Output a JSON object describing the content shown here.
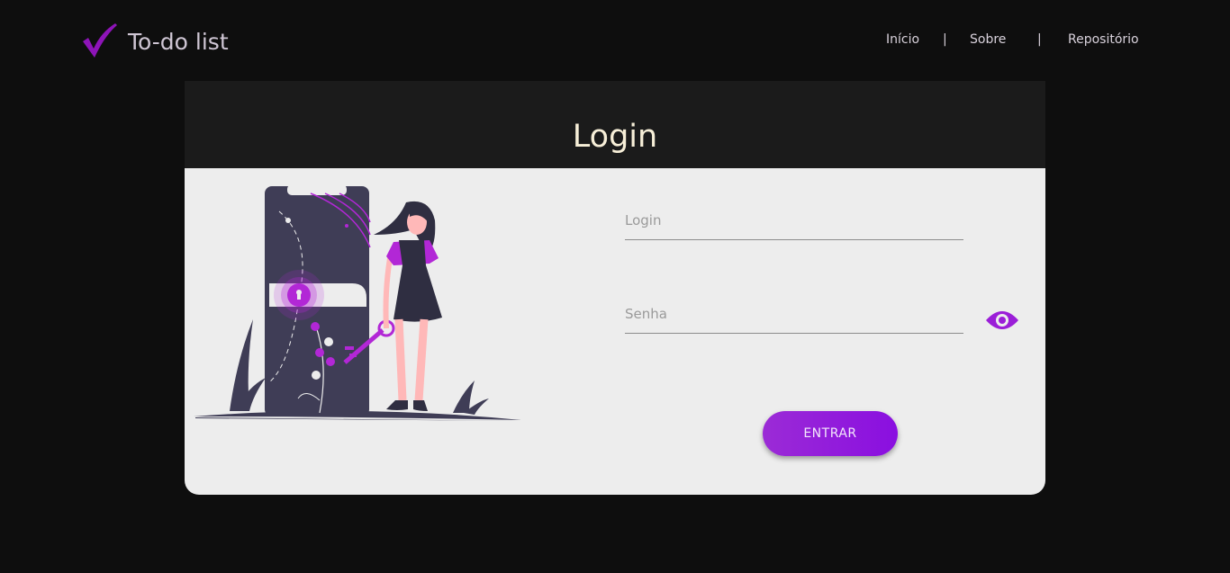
{
  "header": {
    "brand_icon": "checkmark-icon",
    "brand_title": "To-do list",
    "nav": {
      "inicio": "Início",
      "sobre": "Sobre",
      "repositorio": "Repositório",
      "separator": "|"
    }
  },
  "login_card": {
    "title": "Login",
    "illustration": "woman-with-key-unlocking-phone-illustration",
    "fields": {
      "login_placeholder": "Login",
      "senha_placeholder": "Senha"
    },
    "eye_icon": "eye-icon",
    "submit_label": "ENTRAR"
  },
  "colors": {
    "background": "#0e0e0e",
    "card_header": "#1b1b1b",
    "card_body": "#ededed",
    "accent_purple": "#9b2bd6",
    "title_text": "#f7efd8"
  }
}
